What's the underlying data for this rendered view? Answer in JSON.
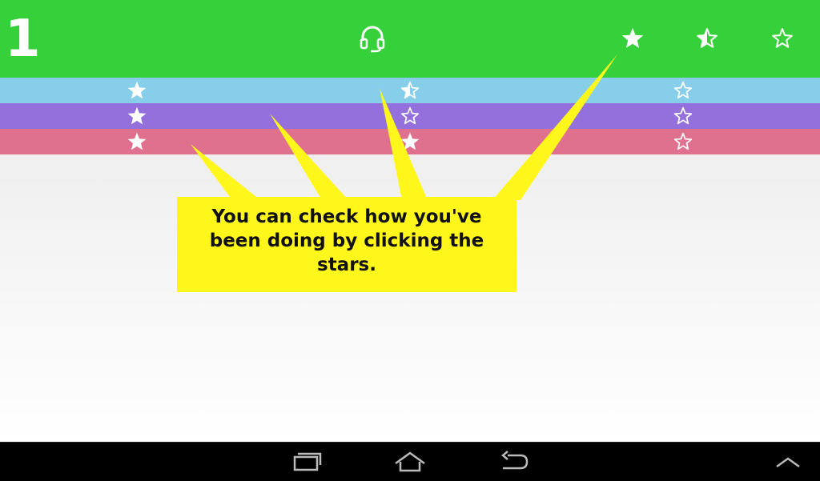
{
  "header": {
    "level_number": "1",
    "headphone_icon": "headphone-icon",
    "stars": [
      "star-filled-icon",
      "star-half-icon",
      "star-outline-icon"
    ],
    "background": "#36d13a"
  },
  "rows": [
    {
      "name": "blue",
      "color": "#87ceeb",
      "stars": [
        "star-filled-icon",
        "star-half-icon",
        "star-outline-icon"
      ]
    },
    {
      "name": "purple",
      "color": "#9470dc",
      "stars": [
        "star-filled-icon",
        "star-outline-icon",
        "star-outline-icon"
      ]
    },
    {
      "name": "pink",
      "color": "#df708e",
      "stars": [
        "star-filled-icon",
        "star-filled-icon",
        "star-outline-icon"
      ]
    }
  ],
  "callout": {
    "text": "You can check how you've been doing by clicking the stars.",
    "color": "#fff71c"
  },
  "navbar": {
    "buttons": [
      "recent-apps-icon",
      "home-icon",
      "back-icon",
      "chevron-up-icon"
    ]
  }
}
